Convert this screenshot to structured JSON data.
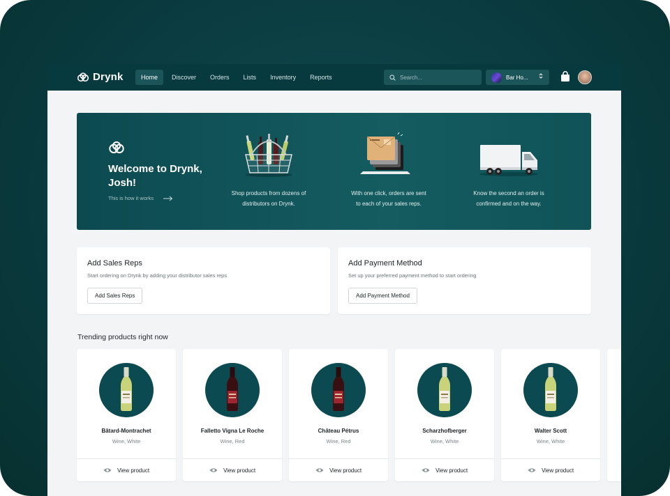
{
  "nav": {
    "brand": "Drynk",
    "links": [
      {
        "label": "Home",
        "active": true
      },
      {
        "label": "Discover",
        "active": false
      },
      {
        "label": "Orders",
        "active": false
      },
      {
        "label": "Lists",
        "active": false
      },
      {
        "label": "Inventory",
        "active": false
      },
      {
        "label": "Reports",
        "active": false
      }
    ],
    "search_placeholder": "Search...",
    "venue_label": "Bar Ho...",
    "icons": {
      "search": "search-icon",
      "venue_switch": "chevron-updown-icon",
      "cart": "shopping-bag-icon",
      "avatar": "avatar"
    }
  },
  "hero": {
    "title": "Welcome to Drynk, Josh!",
    "link_label": "This is how it works",
    "steps": [
      {
        "icon": "basket-bottles-icon",
        "caption_line1": "Shop products from dozens of",
        "caption_line2": "distributors on Drynk."
      },
      {
        "icon": "envelopes-laptop-icon",
        "caption_line1": "With one click, orders are sent",
        "caption_line2": "to each of your sales reps."
      },
      {
        "icon": "delivery-truck-icon",
        "caption_line1": "Know the second an order is",
        "caption_line2": "confirmed and on the way."
      }
    ]
  },
  "cards": {
    "sales_reps": {
      "title": "Add Sales Reps",
      "description": "Start ordering on Drynk by adding your distributor sales reps",
      "button": "Add Sales Reps"
    },
    "payment": {
      "title": "Add Payment Method",
      "description": "Set up your preferred payment method to start ordering",
      "button": "Add Payment Method"
    }
  },
  "trending": {
    "title": "Trending products right now",
    "view_label": "View product",
    "products": [
      {
        "name": "Bâtard-Montrachet",
        "type": "Wine, White",
        "bottle": "white"
      },
      {
        "name": "Falletto Vigna Le Roche",
        "type": "Wine, Red",
        "bottle": "red"
      },
      {
        "name": "Château Pétrus",
        "type": "Wine, Red",
        "bottle": "red"
      },
      {
        "name": "Scharzhofberger",
        "type": "Wine, White",
        "bottle": "white"
      },
      {
        "name": "Walter Scott",
        "type": "Wine, White",
        "bottle": "white"
      }
    ]
  },
  "colors": {
    "frame": "#0a3b40",
    "nav": "#063a3e",
    "accent": "#1b5559",
    "hero": "#0f5357",
    "page": "#f2f4f6"
  }
}
